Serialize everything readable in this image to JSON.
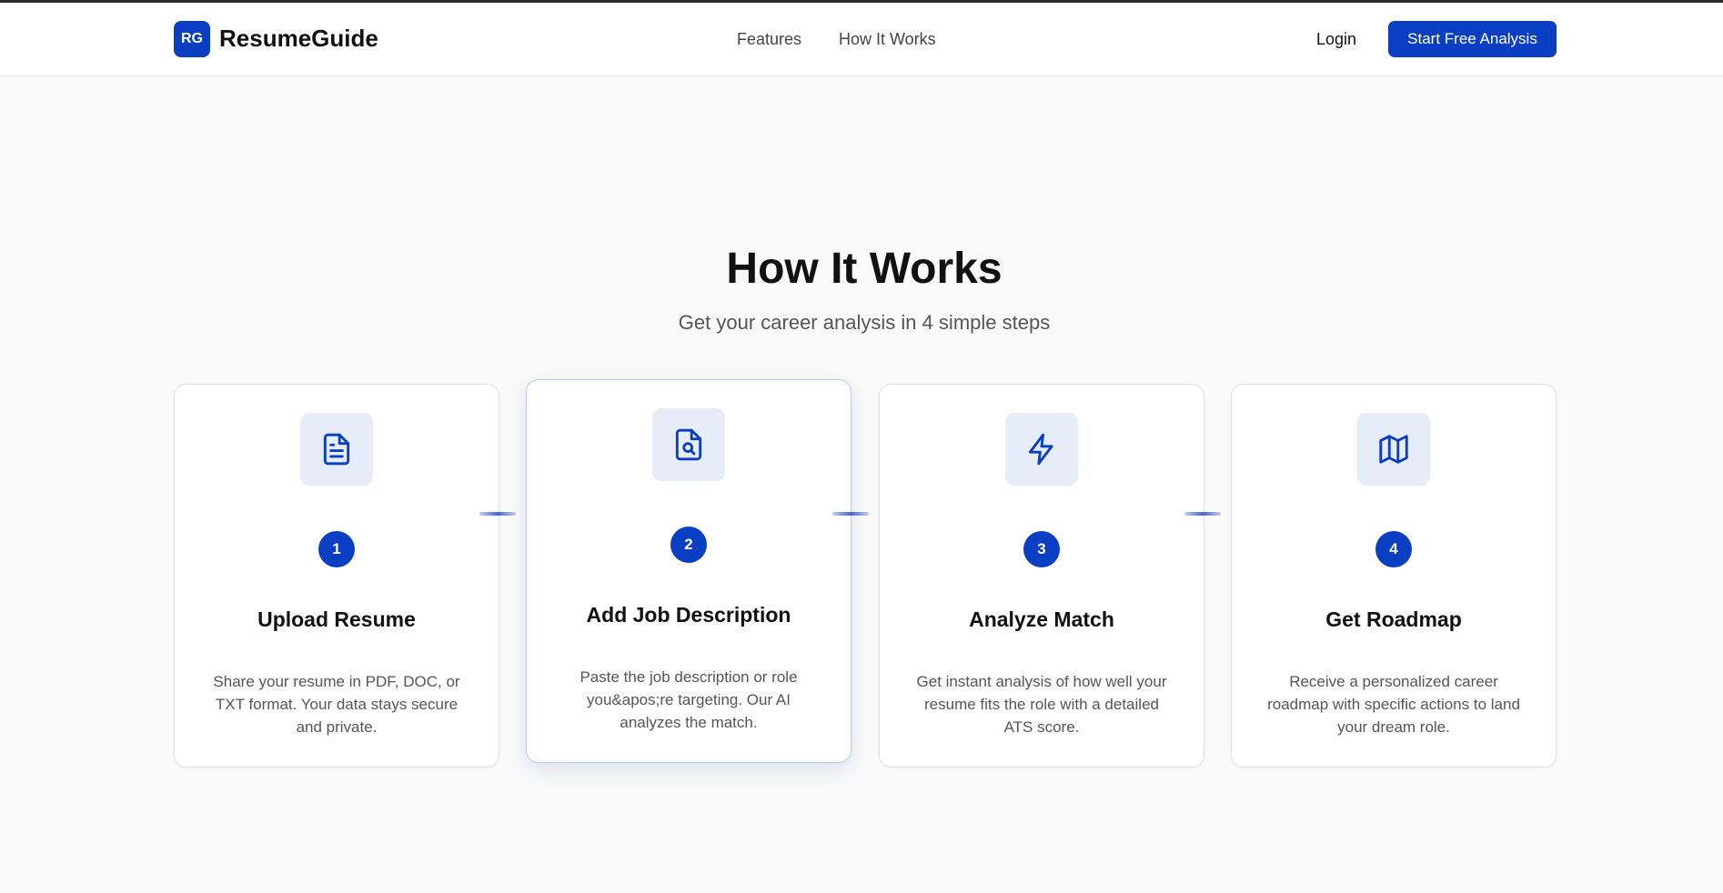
{
  "header": {
    "logo_initials": "RG",
    "brand": "ResumeGuide",
    "nav": [
      "Features",
      "How It Works"
    ],
    "login": "Login",
    "cta": "Start Free Analysis"
  },
  "section": {
    "title": "How It Works",
    "subtitle": "Get your career analysis in 4 simple steps"
  },
  "steps": [
    {
      "number": "1",
      "icon": "document-icon",
      "title": "Upload Resume",
      "description": "Share your resume in PDF, DOC, or TXT format. Your data stays secure and private."
    },
    {
      "number": "2",
      "icon": "file-search-icon",
      "title": "Add Job Description",
      "description": "Paste the job description or role you&apos;re targeting. Our AI analyzes the match."
    },
    {
      "number": "3",
      "icon": "lightning-icon",
      "title": "Analyze Match",
      "description": "Get instant analysis of how well your resume fits the role with a detailed ATS score."
    },
    {
      "number": "4",
      "icon": "map-icon",
      "title": "Get Roadmap",
      "description": "Receive a personalized career roadmap with specific actions to land your dream role."
    }
  ],
  "colors": {
    "accent": "#0a3fc4",
    "icon_tile": "#e6ecf8",
    "background": "#fafafa"
  }
}
